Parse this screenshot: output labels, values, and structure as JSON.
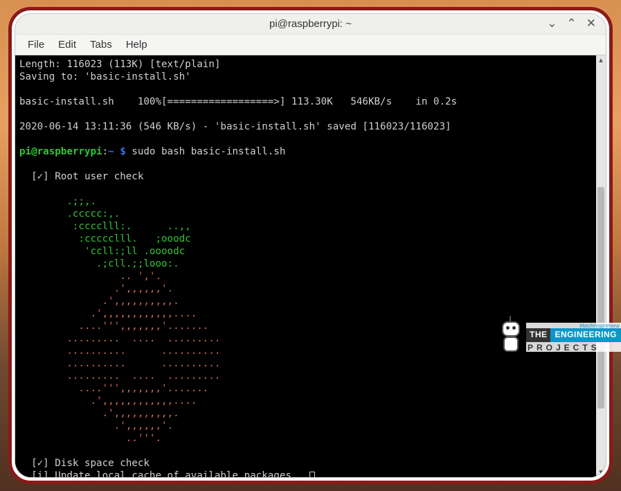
{
  "window": {
    "title": "pi@raspberrypi: ~"
  },
  "menu": {
    "file": "File",
    "edit": "Edit",
    "tabs": "Tabs",
    "help": "Help"
  },
  "win_controls": {
    "min": "⌄",
    "max": "⌃",
    "close": "✕"
  },
  "terminal": {
    "line1": "Length: 116023 (113K) [text/plain]",
    "line2": "Saving to: 'basic-install.sh'",
    "blank": "",
    "line3": "basic-install.sh    100%[==================>] 113.30K   546KB/s    in 0.2s",
    "line4": "2020-06-14 13:11:36 (546 KB/s) - 'basic-install.sh' saved [116023/116023]",
    "prompt_user": "pi@raspberrypi",
    "prompt_sep": ":",
    "prompt_path": "~ $",
    "prompt_cmd": " sudo bash basic-install.sh",
    "check_root": "  [✓] Root user check",
    "leaf1": "        .;;,.",
    "leaf2": "        .ccccc:,.",
    "leaf3": "         :cccclll:.      ..,,",
    "leaf4": "          :ccccclll.   ;ooodc",
    "leaf5": "           'ccll:;ll .oooodc",
    "leaf6": "             .;cll.;;looo:.",
    "berry1": "                 .. ','.",
    "berry2": "                .',,,,,,'.",
    "berry3": "              .',,,,,,,,,,.",
    "berry4": "            .',,,,,,,,,,,,....",
    "berry5": "          ....''',,,,,,,'.......",
    "berry6": "        .........  ....  .........",
    "berry7": "        ..........      ..........",
    "berry8": "        ..........      ..........",
    "berry9": "        .........  ....  .........",
    "berry10": "          ....''',,,,,,,'.......",
    "berry11": "            .',,,,,,,,,,,,....",
    "berry12": "              .',,,,,,,,,,.",
    "berry13": "                .',,,,,,'.",
    "berry14": "                  ..'''.",
    "check_disk": "  [✓] Disk space check",
    "update_pkg": "  [i] Update local cache of available packages..."
  },
  "watermark": {
    "hash": "#technoprenew",
    "the": "THE",
    "eng": "ENGINEERING",
    "proj": "PROJECTS"
  }
}
